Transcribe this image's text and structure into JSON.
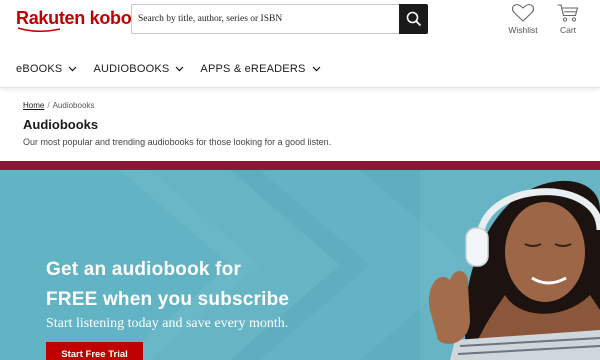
{
  "header": {
    "logo_text": "Rakuten kobo",
    "search": {
      "placeholder": "Search by title, author, series or ISBN",
      "value": ""
    },
    "wishlist_label": "Wishlist",
    "cart_label": "Cart"
  },
  "nav": {
    "items": [
      {
        "label": "eBOOKS"
      },
      {
        "label": "AUDIOBOOKS"
      },
      {
        "label": "APPS & eREADERS"
      }
    ]
  },
  "breadcrumb": {
    "home": "Home",
    "separator": "/",
    "current": "Audiobooks"
  },
  "page": {
    "title": "Audiobooks",
    "subtitle": "Our most popular and trending audiobooks for those looking for a good listen."
  },
  "banner": {
    "headline_line1": "Get an audiobook for",
    "headline_line2": "FREE when you subscribe",
    "subheadline": "Start listening today and save every month.",
    "cta_label": "Start Free Trial"
  },
  "colors": {
    "brand_red": "#bf0000",
    "divider": "#8e1739",
    "banner_bg": "#5eaec0",
    "search_button": "#1a1a1a"
  },
  "icons": [
    "search-icon",
    "heart-icon",
    "cart-icon",
    "chevron-down-icon"
  ]
}
